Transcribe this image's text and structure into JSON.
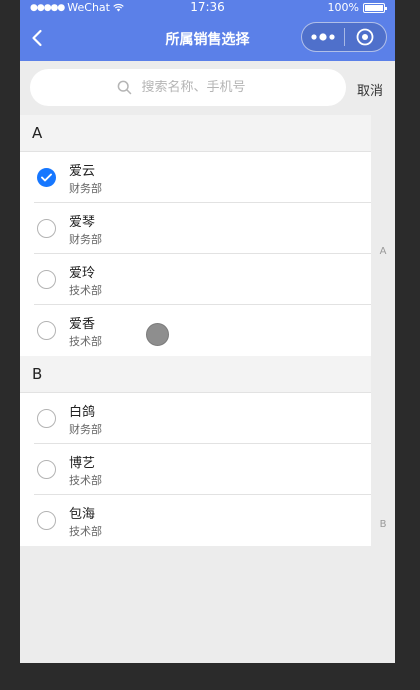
{
  "status": {
    "carrier": "WeChat",
    "time": "17:36",
    "battery": "100%"
  },
  "nav": {
    "title": "所属销售选择"
  },
  "search": {
    "placeholder": "搜索名称、手机号",
    "cancel_label": "取消"
  },
  "sections": [
    {
      "letter": "A",
      "items": [
        {
          "name": "爱云",
          "dept": "财务部",
          "checked": true
        },
        {
          "name": "爱琴",
          "dept": "财务部",
          "checked": false
        },
        {
          "name": "爱玲",
          "dept": "技术部",
          "checked": false
        },
        {
          "name": "爱香",
          "dept": "技术部",
          "checked": false
        }
      ]
    },
    {
      "letter": "B",
      "items": [
        {
          "name": "白鸽",
          "dept": "财务部",
          "checked": false
        },
        {
          "name": "博艺",
          "dept": "技术部",
          "checked": false
        },
        {
          "name": "包海",
          "dept": "技术部",
          "checked": false
        }
      ]
    }
  ],
  "index_letters": [
    "A",
    "B"
  ],
  "colors": {
    "nav_bg": "#5b80e8",
    "checked": "#1677ff"
  }
}
